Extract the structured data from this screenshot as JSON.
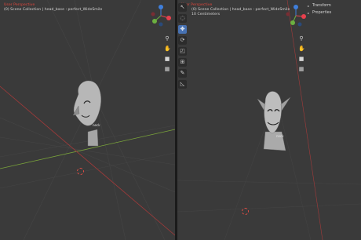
{
  "left_viewport": {
    "perspective_label": "User Perspective",
    "collection_label": "(0) Scene Collection | head_base : perfect_WideSmile",
    "mesh_label": "neck"
  },
  "right_viewport": {
    "perspective_label": "User Perspective",
    "collection_label": "(0) Scene Collection | head_base : perfect_WideSmile",
    "scale_label": "10 Centimeters",
    "mesh_label": "neck"
  },
  "side_panel": {
    "items": [
      {
        "label": "Transform"
      },
      {
        "label": "Properties"
      }
    ]
  },
  "gizmo": {
    "x_color": "#e8404d",
    "y_color": "#6cb040",
    "z_color": "#3f7fdc"
  },
  "icons": {
    "zoom": "zoom-icon",
    "pan": "hand-icon",
    "camera": "camera-icon",
    "ortho": "grid-icon",
    "tools": [
      "cursor-select-icon",
      "circle-select-icon",
      "move-icon",
      "rotate-icon",
      "scale-icon",
      "transform-icon",
      "annotate-icon",
      "measure-icon"
    ]
  }
}
